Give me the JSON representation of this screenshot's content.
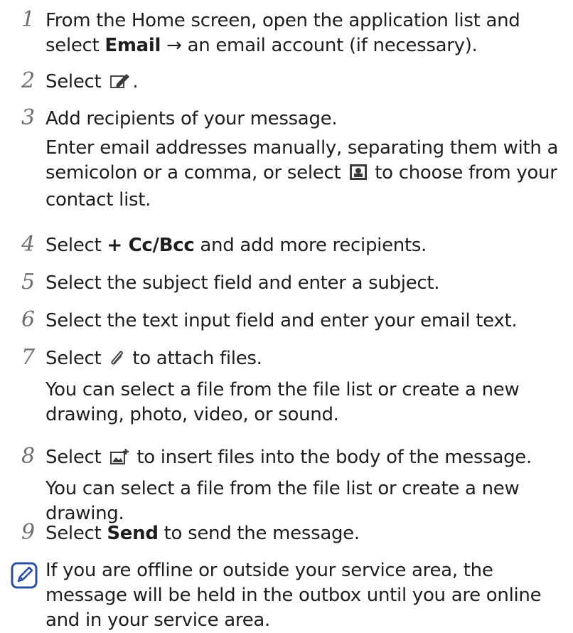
{
  "steps": [
    {
      "number": "1",
      "line1": "From the Home screen, open the application list and",
      "line2a": "select ",
      "bold": "Email",
      "line2b": " → an email account (if necessary)."
    },
    {
      "number": "2",
      "a": "Select ",
      "icon": "compose-icon",
      "b": "."
    },
    {
      "number": "3",
      "main": "Add recipients of your message.",
      "sub1": "Enter email addresses manually, separating them with a",
      "sub2a": "semicolon or a comma, or select ",
      "icon": "contacts-icon",
      "sub2b": " to choose from your",
      "sub3": "contact list."
    },
    {
      "number": "4",
      "a": "Select ",
      "bold": "+ Cc/Bcc",
      "b": " and add more recipients."
    },
    {
      "number": "5",
      "text": "Select the subject field and enter a subject."
    },
    {
      "number": "6",
      "text": "Select the text input field and enter your email text."
    },
    {
      "number": "7",
      "a": "Select ",
      "icon": "attach-icon",
      "b": " to attach files.",
      "sub1": "You can select a file from the file list or create a new",
      "sub2": "drawing, photo, video, or sound."
    },
    {
      "number": "8",
      "a": "Select ",
      "icon": "insert-image-icon",
      "b": " to insert files into the body of the message.",
      "sub1": "You can select a file from the file list or create a new",
      "sub2": "drawing."
    },
    {
      "number": "9",
      "a": "Select ",
      "bold": "Send",
      "b": " to send the message."
    }
  ],
  "note": {
    "icon": "note-icon",
    "line1": "If you are offline or outside your service area, the",
    "line2": "message will be held in the outbox until you are online",
    "line3": "and in your service area."
  }
}
